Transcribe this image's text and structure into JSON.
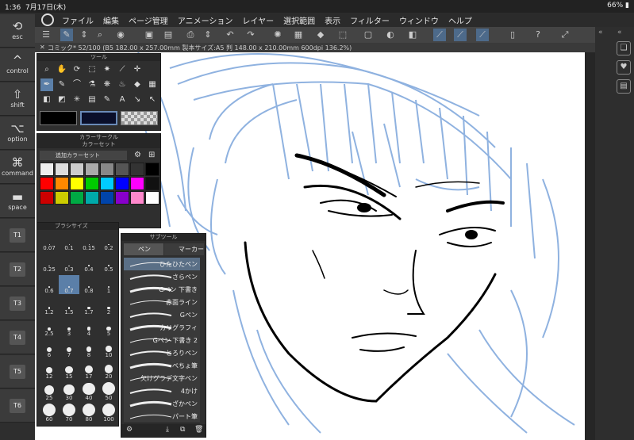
{
  "status": {
    "time": "1:36",
    "date": "7月17日(木)",
    "battery": "66%"
  },
  "menu": {
    "items": [
      "ファイル",
      "編集",
      "ページ管理",
      "アニメーション",
      "レイヤー",
      "選択範囲",
      "表示",
      "フィルター",
      "ウィンドウ",
      "ヘルプ"
    ]
  },
  "modifiers": [
    {
      "label": "esc",
      "icon": "⟲"
    },
    {
      "label": "control",
      "icon": "^"
    },
    {
      "label": "shift",
      "icon": "⇧"
    },
    {
      "label": "option",
      "icon": "⌥"
    },
    {
      "label": "command",
      "icon": "⌘"
    },
    {
      "label": "space",
      "icon": "▬"
    }
  ],
  "tkeys": [
    "T1",
    "T2",
    "T3",
    "T4",
    "T5",
    "T6"
  ],
  "canvas_tab": "コミック* 52/100 (B5 182.00 x 257.00mm 製本サイズ:A5 判 148.00 x 210.00mm 600dpi 136.2%)",
  "tool_panel": {
    "title": "ツール"
  },
  "color_circle": {
    "title": "カラーサークル"
  },
  "color_set": {
    "title": "カラーセット",
    "name": "追加カラーセット",
    "colors": [
      "#eeeeee",
      "#dddddd",
      "#cccccc",
      "#aaaaaa",
      "#888888",
      "#555555",
      "#333333",
      "#000000",
      "#ff0000",
      "#ff8800",
      "#ffff00",
      "#00cc00",
      "#00ccff",
      "#0000ff",
      "#ff00ff",
      "#111111",
      "#cc0000",
      "#cccc00",
      "#00aa44",
      "#00aaaa",
      "#0044aa",
      "#8800cc",
      "#ff88cc",
      "#ffffff"
    ]
  },
  "brush_size": {
    "title": "ブラシサイズ",
    "sizes": [
      "0.07",
      "0.1",
      "0.15",
      "0.2",
      "0.25",
      "0.3",
      "0.4",
      "0.5",
      "0.6",
      "0.7",
      "0.8",
      "1",
      "1.2",
      "1.5",
      "1.7",
      "2",
      "2.5",
      "3",
      "4",
      "5",
      "6",
      "7",
      "8",
      "10",
      "12",
      "15",
      "17",
      "20",
      "25",
      "30",
      "40",
      "50",
      "60",
      "70",
      "80",
      "100"
    ]
  },
  "subtool": {
    "title": "サブツール",
    "tab_pen": "ペン",
    "tab_marker": "マーカー",
    "items": [
      "ひたひたペン",
      "さらペン",
      "Gペン 下書き",
      "赤面ライン",
      "Gペン",
      "カリグラフィ",
      "Gペン 下書き 2",
      "とろりペン",
      "べちょ筆",
      "欠けグラデ文字ペン",
      "4かけ",
      "ざかペン",
      "パート筆"
    ]
  }
}
